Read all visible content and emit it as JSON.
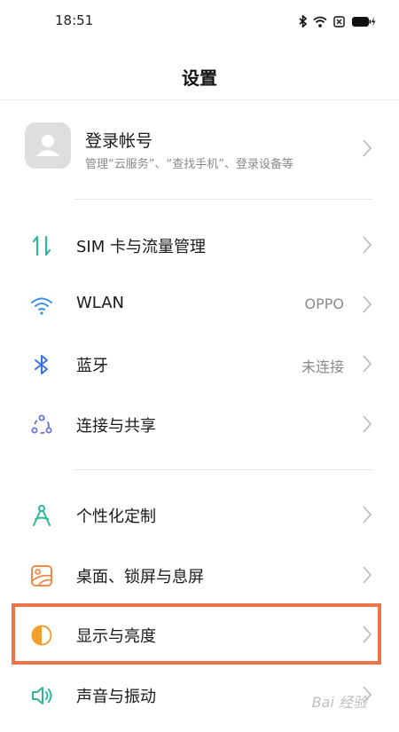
{
  "status_bar": {
    "time": "18:51"
  },
  "header": {
    "title": "设置"
  },
  "account": {
    "title": "登录帐号",
    "subtitle": "管理“云服务”、“查找手机”、登录设备等"
  },
  "items": [
    {
      "label": "SIM 卡与流量管理",
      "value": ""
    },
    {
      "label": "WLAN",
      "value": "OPPO"
    },
    {
      "label": "蓝牙",
      "value": "未连接"
    },
    {
      "label": "连接与共享",
      "value": ""
    },
    {
      "label": "个性化定制",
      "value": ""
    },
    {
      "label": "桌面、锁屏与息屏",
      "value": ""
    },
    {
      "label": "显示与亮度",
      "value": ""
    },
    {
      "label": "声音与振动",
      "value": ""
    }
  ],
  "icons": [
    "sim-data-icon",
    "wifi-icon",
    "bluetooth-icon",
    "connection-share-icon",
    "personalization-icon",
    "wallpaper-icon",
    "display-brightness-icon",
    "sound-icon"
  ],
  "colors": {
    "highlight": "#ec7446",
    "sim": "#2fb79a",
    "wifi": "#3a8ef0",
    "bluetooth": "#3a73e0",
    "connection": "#6c72d6",
    "personalization": "#2fb79a",
    "wallpaper": "#f08a4b",
    "display": "#f0a030",
    "sound": "#2fb79a"
  },
  "watermark": "Bai 经验"
}
